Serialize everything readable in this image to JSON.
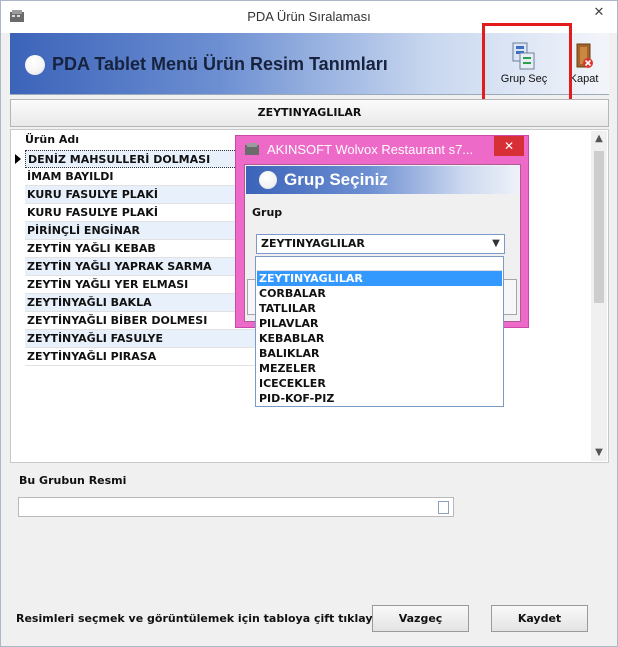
{
  "window": {
    "title": "PDA Ürün Sıralaması",
    "close_glyph": "✕"
  },
  "banner": {
    "heading": "PDA Tablet Menü Ürün Resim Tanımları"
  },
  "toolbar": {
    "group_select_label": "Grup Seç",
    "close_label": "Kapat"
  },
  "group_header": "ZEYTINYAGLILAR",
  "grid": {
    "column_header": "Ürün Adı",
    "rows": [
      "DENİZ MAHSULLERİ DOLMASI",
      "İMAM BAYILDI",
      "KURU FASULYE PLAKİ",
      "KURU FASULYE PLAKİ",
      "PİRİNÇLİ ENGİNAR",
      "ZEYTİN YAĞLI KEBAB",
      "ZEYTİN YAĞLI YAPRAK SARMA",
      "ZEYTİN YAĞLI YER ELMASI",
      "ZEYTİNYAĞLI BAKLA",
      "ZEYTİNYAĞLI BİBER DOLMESI",
      "ZEYTİNYAĞLI FASULYE",
      "ZEYTİNYAĞLI PIRASA"
    ]
  },
  "image_section": {
    "label": "Bu Grubun Resmi"
  },
  "footer": {
    "hint": "Resimleri seçmek ve görüntülemek için tabloya çift tıklayınız.",
    "cancel_label": "Vazgeç",
    "save_label": "Kaydet"
  },
  "dialog": {
    "title": "AKINSOFT Wolvox Restaurant s7...",
    "heading": "Grup Seçiniz",
    "group_label": "Grup",
    "selected": "ZEYTINYAGLILAR",
    "options": [
      "ZEYTINYAGLILAR",
      "CORBALAR",
      "TATLILAR",
      "PILAVLAR",
      "KEBABLAR",
      "BALIKLAR",
      "MEZELER",
      "ICECEKLER",
      "PID-KOF-PIZ"
    ]
  },
  "colors": {
    "highlight": "#e41b1b",
    "dialog_frame": "#ee6ac8",
    "selection": "#3399ff",
    "row_alt": "#e7f0fb"
  }
}
